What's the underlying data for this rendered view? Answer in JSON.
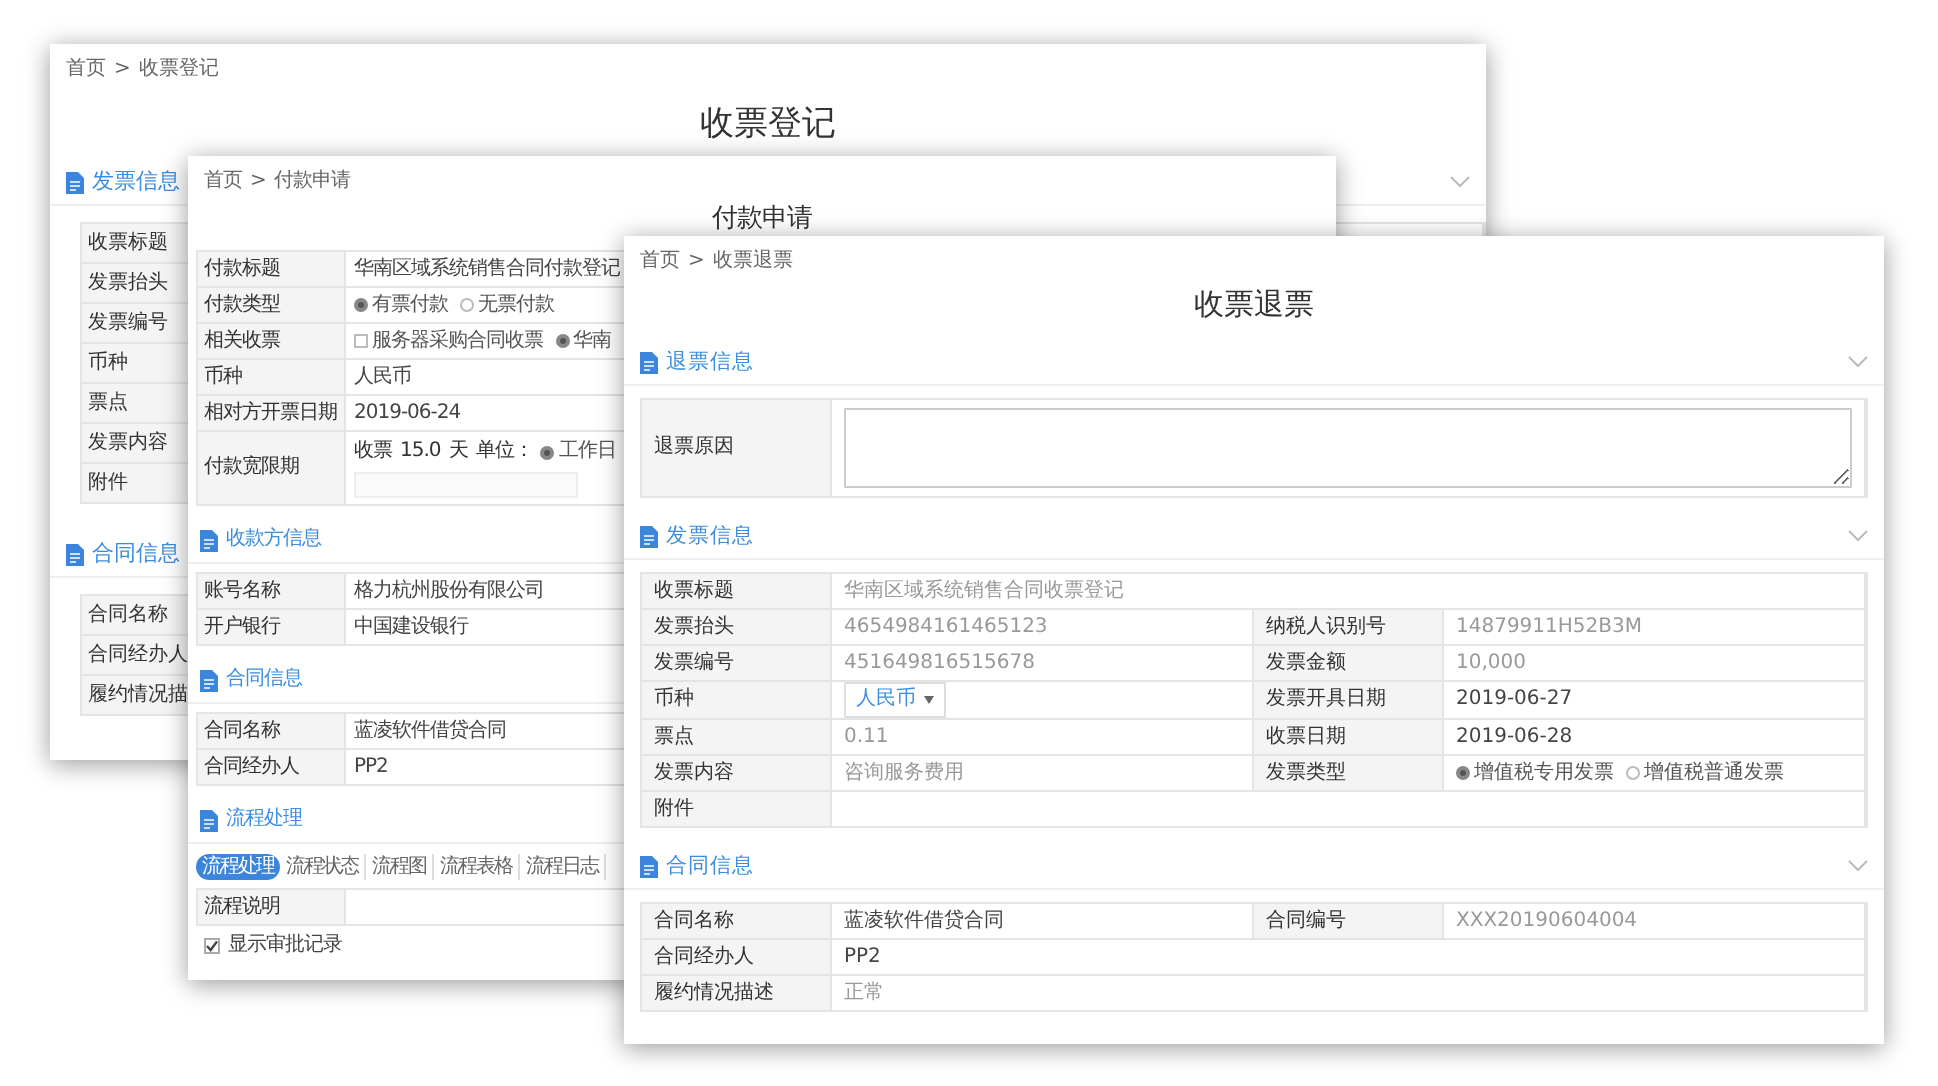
{
  "windows": [
    {
      "breadcrumb": {
        "items": [
          "首页",
          "收票登记"
        ],
        "separator": ">"
      },
      "title": "收票登记",
      "sections": [
        {
          "title": "发票信息",
          "chevron": true,
          "rows": [
            {
              "cells": [
                {
                  "label": "收票标题"
                }
              ]
            },
            {
              "cells": [
                {
                  "label": "发票抬头"
                }
              ]
            },
            {
              "cells": [
                {
                  "label": "发票编号"
                }
              ]
            },
            {
              "cells": [
                {
                  "label": "币种"
                }
              ]
            },
            {
              "cells": [
                {
                  "label": "票点"
                }
              ]
            },
            {
              "cells": [
                {
                  "label": "发票内容"
                }
              ]
            },
            {
              "cells": [
                {
                  "label": "附件"
                }
              ]
            }
          ]
        },
        {
          "title": "合同信息",
          "rows": [
            {
              "cells": [
                {
                  "label": "合同名称"
                }
              ]
            },
            {
              "cells": [
                {
                  "label": "合同经办人"
                }
              ]
            },
            {
              "cells": [
                {
                  "label": "履约情况描"
                }
              ]
            }
          ]
        }
      ]
    },
    {
      "breadcrumb": {
        "items": [
          "首页",
          "付款申请"
        ],
        "separator": ">"
      },
      "title": "付款申请",
      "sections": [
        {
          "rows": [
            {
              "cells": [
                {
                  "label": "付款标题",
                  "kind": "text",
                  "value": "华南区域系统销售合同付款登记"
                }
              ]
            },
            {
              "cells": [
                {
                  "label": "付款类型",
                  "kind": "options",
                  "options": [
                    {
                      "kind": "radio",
                      "label": "有票付款",
                      "selected": true
                    },
                    {
                      "kind": "radio",
                      "label": "无票付款",
                      "selected": false
                    }
                  ]
                }
              ]
            },
            {
              "cells": [
                {
                  "label": "相关收票",
                  "kind": "options",
                  "options": [
                    {
                      "kind": "checkbox",
                      "label": "服务器采购合同收票",
                      "checked": false
                    },
                    {
                      "kind": "radio",
                      "label": "华南",
                      "selected": true
                    }
                  ]
                }
              ]
            },
            {
              "cells": [
                {
                  "label": "币种",
                  "kind": "text",
                  "value": "人民币"
                }
              ]
            },
            {
              "cells": [
                {
                  "label": "相对方开票日期",
                  "kind": "text",
                  "value": "2019-06-24"
                }
              ]
            },
            {
              "cells": [
                {
                  "label": "付款宽限期",
                  "kind": "grace",
                  "prefix": "收票",
                  "amount": "15.0",
                  "unit": "天",
                  "unit_label": "单位：",
                  "options": [
                    {
                      "kind": "radio",
                      "label": "工作日",
                      "selected": true
                    }
                  ]
                }
              ]
            }
          ]
        },
        {
          "title": "收款方信息",
          "rows": [
            {
              "cells": [
                {
                  "label": "账号名称",
                  "kind": "text",
                  "value": "格力杭州股份有限公司"
                }
              ]
            },
            {
              "cells": [
                {
                  "label": "开户银行",
                  "kind": "text",
                  "value": "中国建设银行"
                }
              ]
            }
          ]
        },
        {
          "title": "合同信息",
          "rows": [
            {
              "cells": [
                {
                  "label": "合同名称",
                  "kind": "text",
                  "value": "蓝凌软件借贷合同"
                }
              ]
            },
            {
              "cells": [
                {
                  "label": "合同经办人",
                  "kind": "text",
                  "value": "PP2"
                }
              ]
            }
          ]
        },
        {
          "title": "流程处理",
          "tabs": [
            {
              "label": "流程处理",
              "selected": true
            },
            {
              "label": "流程状态",
              "selected": false
            },
            {
              "label": "流程图",
              "selected": false
            },
            {
              "label": "流程表格",
              "selected": false
            },
            {
              "label": "流程日志",
              "selected": false
            }
          ],
          "rows": [
            {
              "cells": [
                {
                  "label": "流程说明",
                  "kind": "empty"
                }
              ]
            }
          ],
          "checkbox": {
            "label": "显示审批记录",
            "checked": true
          }
        }
      ]
    },
    {
      "breadcrumb": {
        "items": [
          "首页",
          "收票退票"
        ],
        "separator": ">"
      },
      "title": "收票退票",
      "sections": [
        {
          "title": "退票信息",
          "chevron": true,
          "rows": [
            {
              "cells": [
                {
                  "label": "退票原因",
                  "kind": "textarea"
                }
              ]
            }
          ]
        },
        {
          "title": "发票信息",
          "chevron": true,
          "rows": [
            {
              "cells": [
                {
                  "label": "收票标题",
                  "kind": "text",
                  "value": "华南区域系统销售合同收票登记",
                  "disabled": true
                }
              ]
            },
            {
              "cells": [
                {
                  "label": "发票抬头",
                  "kind": "text",
                  "value": "4654984161465123",
                  "disabled": true
                },
                {
                  "label": "纳税人识别号",
                  "kind": "text",
                  "value": "14879911H52B3M",
                  "disabled": true
                }
              ]
            },
            {
              "cells": [
                {
                  "label": "发票编号",
                  "kind": "text",
                  "value": "451649816515678",
                  "disabled": true
                },
                {
                  "label": "发票金额",
                  "kind": "text",
                  "value": "10,000",
                  "disabled": true
                }
              ]
            },
            {
              "cells": [
                {
                  "label": "币种",
                  "kind": "select",
                  "value": "人民币"
                },
                {
                  "label": "发票开具日期",
                  "kind": "text",
                  "value": "2019-06-27",
                  "disabled": false
                }
              ]
            },
            {
              "cells": [
                {
                  "label": "票点",
                  "kind": "text",
                  "value": "0.11",
                  "disabled": true
                },
                {
                  "label": "收票日期",
                  "kind": "text",
                  "value": "2019-06-28",
                  "disabled": false
                }
              ]
            },
            {
              "cells": [
                {
                  "label": "发票内容",
                  "kind": "text",
                  "value": "咨询服务费用",
                  "disabled": true
                },
                {
                  "label": "发票类型",
                  "kind": "options",
                  "options": [
                    {
                      "kind": "radio",
                      "label": "增值税专用发票",
                      "selected": true
                    },
                    {
                      "kind": "radio",
                      "label": "增值税普通发票",
                      "selected": false
                    }
                  ]
                }
              ]
            },
            {
              "cells": [
                {
                  "label": "附件",
                  "kind": "empty"
                }
              ]
            }
          ]
        },
        {
          "title": "合同信息",
          "chevron": true,
          "rows": [
            {
              "cells": [
                {
                  "label": "合同名称",
                  "kind": "text",
                  "value": "蓝凌软件借贷合同",
                  "disabled": false
                },
                {
                  "label": "合同编号",
                  "kind": "text",
                  "value": "XXX20190604004",
                  "disabled": true
                }
              ]
            },
            {
              "cells": [
                {
                  "label": "合同经办人",
                  "kind": "text",
                  "value": "PP2",
                  "disabled": false
                }
              ]
            },
            {
              "cells": [
                {
                  "label": "履约情况描述",
                  "kind": "text",
                  "value": "正常",
                  "disabled": true
                }
              ]
            }
          ]
        }
      ]
    }
  ]
}
